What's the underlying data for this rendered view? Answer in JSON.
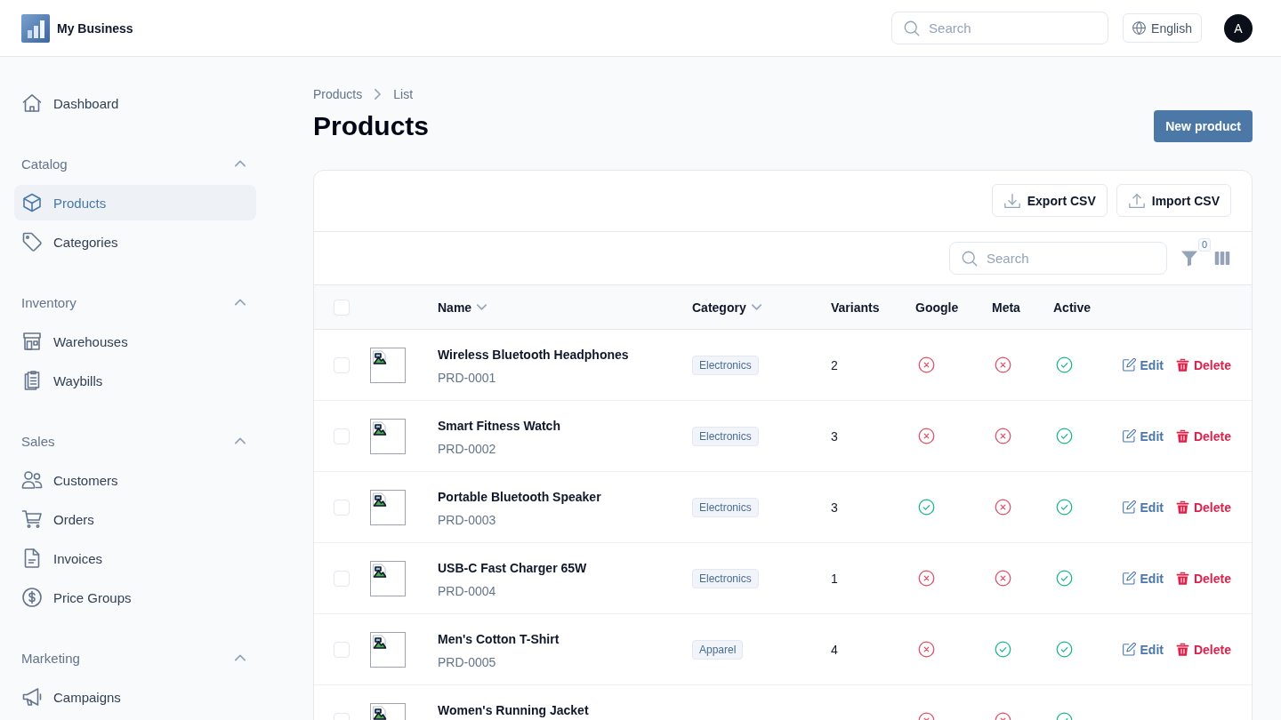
{
  "header": {
    "brand": "My Business",
    "search": {
      "placeholder": "Search"
    },
    "language": "English",
    "avatar": "A"
  },
  "sidebar": {
    "items": [
      {
        "label": "Dashboard",
        "selected": false
      }
    ],
    "groups": [
      {
        "title": "Catalog",
        "expanded": true,
        "items": [
          {
            "label": "Products",
            "selected": true
          },
          {
            "label": "Categories",
            "selected": false
          }
        ]
      },
      {
        "title": "Inventory",
        "expanded": true,
        "items": [
          {
            "label": "Warehouses",
            "selected": false
          },
          {
            "label": "Waybills",
            "selected": false
          }
        ]
      },
      {
        "title": "Sales",
        "expanded": true,
        "items": [
          {
            "label": "Customers",
            "selected": false
          },
          {
            "label": "Orders",
            "selected": false
          },
          {
            "label": "Invoices",
            "selected": false
          },
          {
            "label": "Price Groups",
            "selected": false
          }
        ]
      },
      {
        "title": "Marketing",
        "expanded": true,
        "items": [
          {
            "label": "Campaigns",
            "selected": false
          }
        ]
      }
    ]
  },
  "breadcrumb": [
    "Products",
    "List"
  ],
  "page_title": "Products",
  "primary_button": "New product",
  "toolbar": {
    "buttons": [
      {
        "label": "Export CSV",
        "kind": "export"
      },
      {
        "label": "Import CSV",
        "kind": "import"
      }
    ],
    "search": {
      "placeholder": "Search"
    },
    "filter_count": "0"
  },
  "table": {
    "all_checked": false,
    "columns": [
      {
        "label": "Name",
        "sortable": true
      },
      {
        "label": "Category",
        "sortable": true
      },
      {
        "label": "Variants",
        "sortable": false
      },
      {
        "label": "Google",
        "sortable": false
      },
      {
        "label": "Meta",
        "sortable": false
      },
      {
        "label": "Active",
        "sortable": false
      }
    ],
    "rows": [
      {
        "checked": false,
        "name": "Wireless Bluetooth Headphones",
        "sku": "PRD-0001",
        "category": "Electronics",
        "variants": "2",
        "google": false,
        "meta": false,
        "active": true,
        "actions": [
          {
            "label": "Edit",
            "kind": "edit"
          },
          {
            "label": "Delete",
            "kind": "delete"
          }
        ]
      },
      {
        "checked": false,
        "name": "Smart Fitness Watch",
        "sku": "PRD-0002",
        "category": "Electronics",
        "variants": "3",
        "google": false,
        "meta": false,
        "active": true,
        "actions": [
          {
            "label": "Edit",
            "kind": "edit"
          },
          {
            "label": "Delete",
            "kind": "delete"
          }
        ]
      },
      {
        "checked": false,
        "name": "Portable Bluetooth Speaker",
        "sku": "PRD-0003",
        "category": "Electronics",
        "variants": "3",
        "google": true,
        "meta": false,
        "active": true,
        "actions": [
          {
            "label": "Edit",
            "kind": "edit"
          },
          {
            "label": "Delete",
            "kind": "delete"
          }
        ]
      },
      {
        "checked": false,
        "name": "USB-C Fast Charger 65W",
        "sku": "PRD-0004",
        "category": "Electronics",
        "variants": "1",
        "google": false,
        "meta": false,
        "active": true,
        "actions": [
          {
            "label": "Edit",
            "kind": "edit"
          },
          {
            "label": "Delete",
            "kind": "delete"
          }
        ]
      },
      {
        "checked": false,
        "name": "Men's Cotton T-Shirt",
        "sku": "PRD-0005",
        "category": "Apparel",
        "variants": "4",
        "google": false,
        "meta": true,
        "active": true,
        "actions": [
          {
            "label": "Edit",
            "kind": "edit"
          },
          {
            "label": "Delete",
            "kind": "delete"
          }
        ]
      },
      {
        "checked": false,
        "name": "Women's Running Jacket",
        "google": false,
        "meta": false,
        "active": true
      }
    ]
  }
}
